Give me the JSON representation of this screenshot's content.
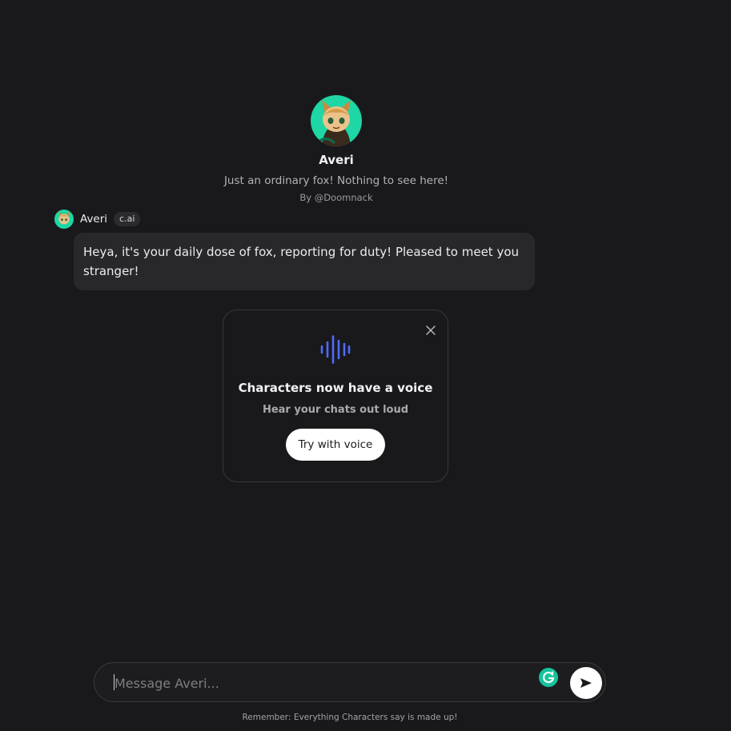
{
  "character": {
    "name": "Averi",
    "tagline": "Just an ordinary fox! Nothing to see here!",
    "author": "By @Doomnack"
  },
  "message": {
    "author": "Averi",
    "badge": "c.ai",
    "text": "Heya, it's your daily dose of fox, reporting for duty! Pleased to meet you stranger!"
  },
  "voice_card": {
    "title": "Characters now have a voice",
    "subtitle": "Hear your chats out loud",
    "button_label": "Try with voice"
  },
  "input": {
    "placeholder": "Message Averi...",
    "value": ""
  },
  "disclaimer": "Remember: Everything Characters say is made up!",
  "colors": {
    "background": "#19191b",
    "bubble": "#28282b",
    "accent_wave": "#4f6bff",
    "avatar_bg": "#1fd6a5"
  }
}
